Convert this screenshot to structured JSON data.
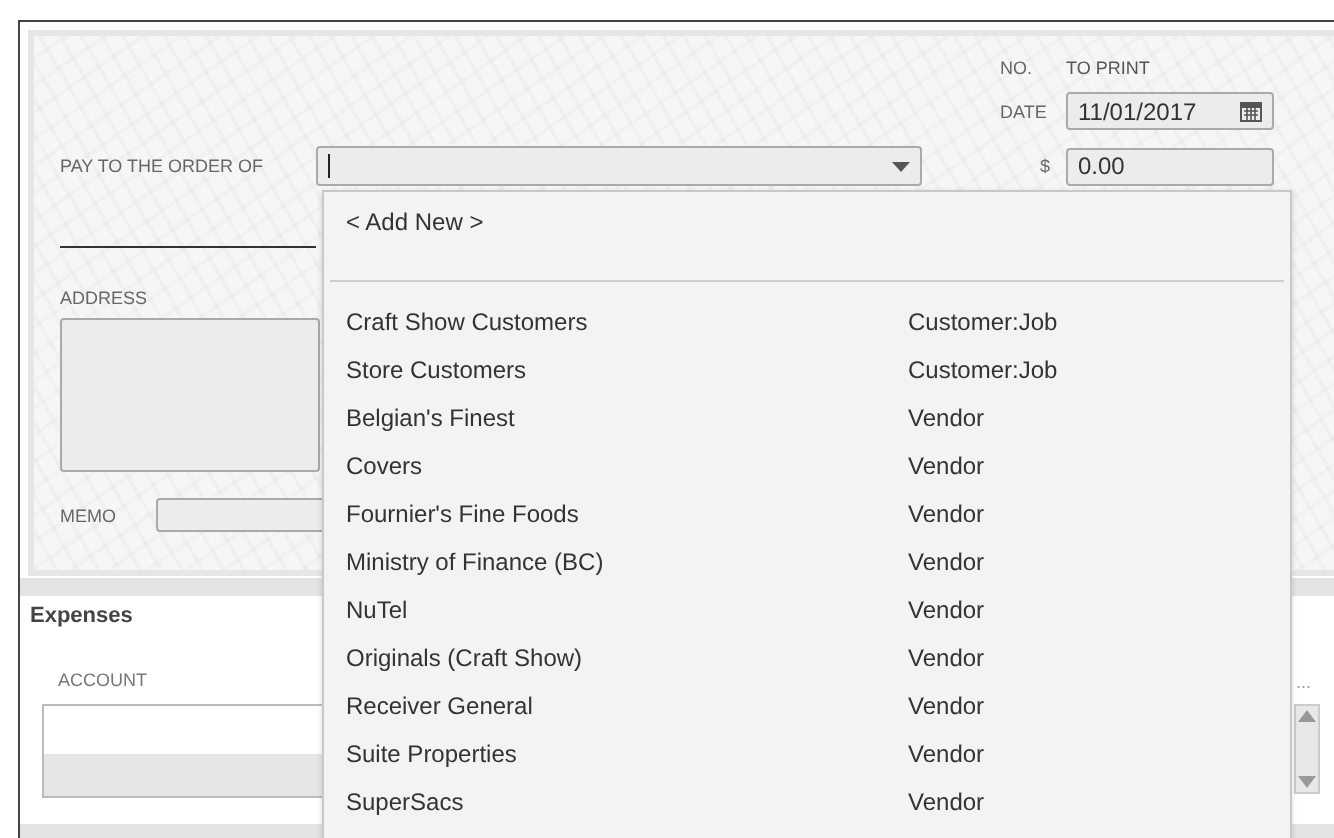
{
  "check": {
    "no_label": "NO.",
    "number": "TO PRINT",
    "date_label": "DATE",
    "date": "11/01/2017",
    "pay_label": "PAY TO THE ORDER OF",
    "amount_label": "$",
    "amount": "0.00",
    "address_label": "ADDRESS",
    "memo_label": "MEMO"
  },
  "dropdown": {
    "add_new": "< Add New >",
    "items": [
      {
        "name": "Craft Show Customers",
        "type": "Customer:Job"
      },
      {
        "name": "Store Customers",
        "type": "Customer:Job"
      },
      {
        "name": "Belgian's Finest",
        "type": "Vendor"
      },
      {
        "name": "Covers",
        "type": "Vendor"
      },
      {
        "name": "Fournier's Fine Foods",
        "type": "Vendor"
      },
      {
        "name": "Ministry of Finance (BC)",
        "type": "Vendor"
      },
      {
        "name": "NuTel",
        "type": "Vendor"
      },
      {
        "name": "Originals (Craft Show)",
        "type": "Vendor"
      },
      {
        "name": "Receiver General",
        "type": "Vendor"
      },
      {
        "name": "Suite Properties",
        "type": "Vendor"
      },
      {
        "name": "SuperSacs",
        "type": "Vendor"
      }
    ]
  },
  "expenses": {
    "tab": "Expenses",
    "column": "ACCOUNT",
    "more": "..."
  }
}
